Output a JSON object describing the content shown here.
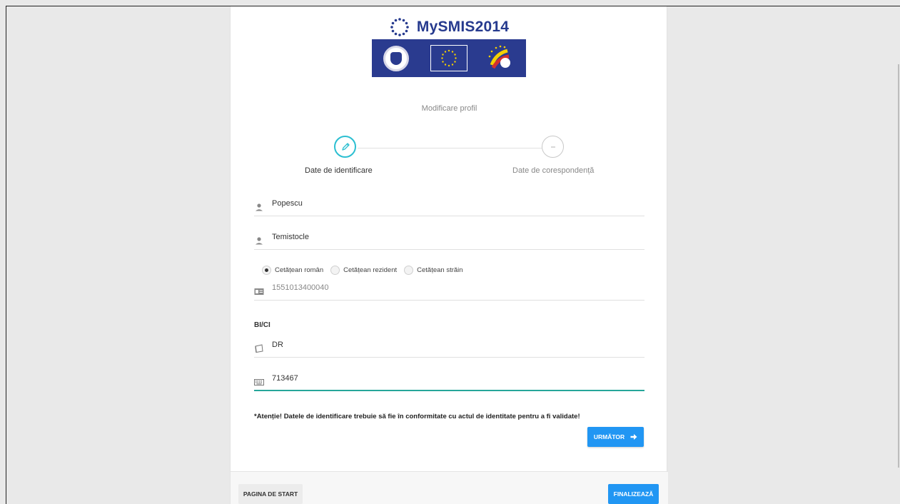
{
  "header": {
    "app_title": "MySMIS2014"
  },
  "page": {
    "subtitle": "Modificare profil"
  },
  "steps": [
    {
      "label": "Date de identificare",
      "state": "active"
    },
    {
      "label": "Date de corespondență",
      "state": "inactive"
    }
  ],
  "form": {
    "last_name": "Popescu",
    "first_name": "Temistocle",
    "citizenship_options": [
      {
        "label": "Cetățean român",
        "checked": true
      },
      {
        "label": "Cetățean rezident",
        "checked": false
      },
      {
        "label": "Cetățean străin",
        "checked": false
      }
    ],
    "cnp": "1551013400040",
    "document_section_label": "BI/CI",
    "id_series": "DR",
    "id_number": "713467",
    "warning": "*Atenție! Datele de identificare trebuie să fie în conformitate cu actul de identitate pentru a fi validate!"
  },
  "buttons": {
    "next": "URMĂTOR",
    "home": "PAGINA DE START",
    "finish": "FINALIZEAZĂ"
  },
  "colors": {
    "brand": "#263a8e",
    "accent_teal": "#2cbfd1",
    "primary_button": "#2196f3",
    "active_underline": "#26a69a"
  }
}
